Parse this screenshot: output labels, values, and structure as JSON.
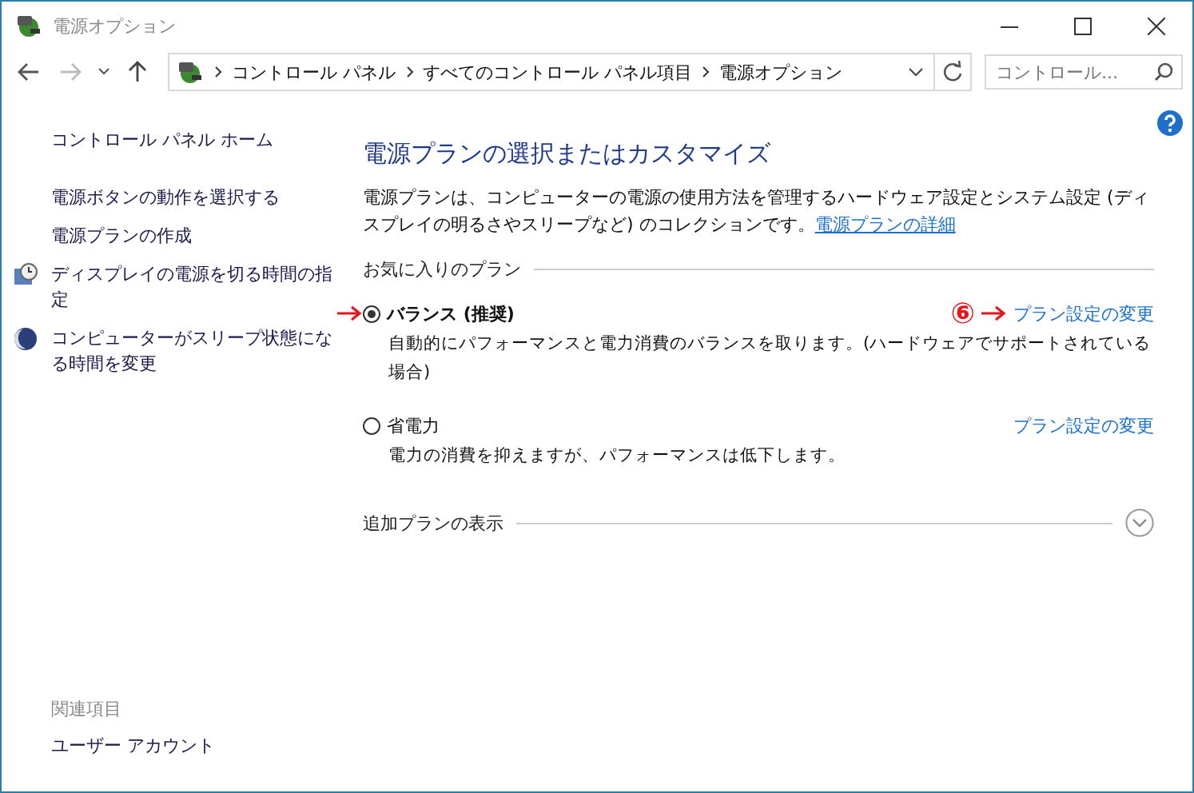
{
  "window": {
    "title": "電源オプション"
  },
  "address_bar": {
    "breadcrumbs": [
      "コントロール パネル",
      "すべてのコントロール パネル項目",
      "電源オプション"
    ]
  },
  "search": {
    "placeholder": "コントロール..."
  },
  "sidebar": {
    "home": "コントロール パネル ホーム",
    "items": [
      {
        "label": "電源ボタンの動作を選択する",
        "kind": "plain"
      },
      {
        "label": "電源プランの作成",
        "kind": "plain"
      },
      {
        "label": "ディスプレイの電源を切る時間の指定",
        "kind": "clock"
      },
      {
        "label": "コンピューターがスリープ状態になる時間を変更",
        "kind": "moon"
      }
    ]
  },
  "see_also": {
    "heading": "関連項目",
    "items": [
      "ユーザー アカウント"
    ]
  },
  "main": {
    "heading": "電源プランの選択またはカスタマイズ",
    "description": "電源プランは、コンピューターの電源の使用方法を管理するハードウェア設定とシステム設定 (ディスプレイの明るさやスリープなど) のコレクションです。",
    "details_link": "電源プランの詳細",
    "section": "お気に入りのプラン",
    "plans": [
      {
        "name": "バランス (推奨)",
        "description": "自動的にパフォーマンスと電力消費のバランスを取ります。(ハードウェアでサポートされている場合)",
        "link": "プラン設定の変更",
        "selected": true,
        "pointer": true,
        "callout": "⑥"
      },
      {
        "name": "省電力",
        "description": "電力の消費を抑えますが、パフォーマンスは低下します。",
        "link": "プラン設定の変更",
        "selected": false,
        "pointer": false
      }
    ],
    "more_plans": {
      "label": "追加プランの表示",
      "expanded": false
    }
  }
}
